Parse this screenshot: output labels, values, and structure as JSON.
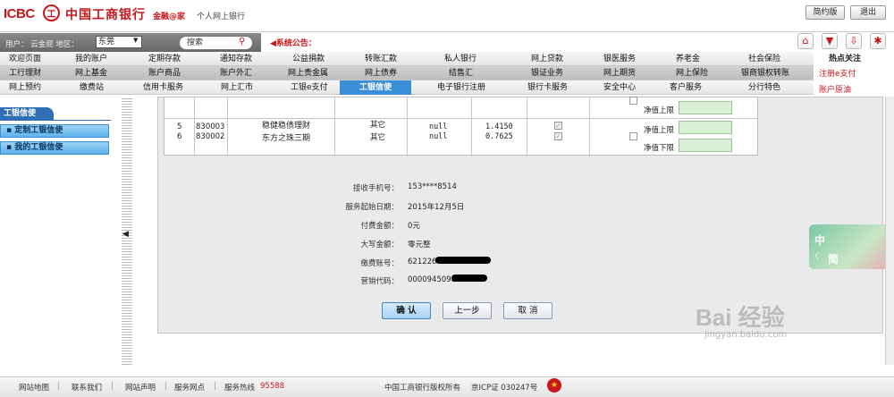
{
  "header": {
    "logo_text": "ICBC",
    "seal_glyph": "工",
    "bank_name": "中国工商银行",
    "slogan": "金融@家",
    "subtitle": "个人网上银行",
    "simple_btn": "简约版",
    "exit_btn": "退出"
  },
  "userbar": {
    "user_label": "用户： 云金屁   地区：",
    "region": "东莞",
    "search_placeholder": "搜索",
    "announcement": "◀系统公告："
  },
  "nav": {
    "row1": [
      "欢迎页面",
      "我的账户",
      "定期存款",
      "通知存款",
      "公益捐款",
      "转账汇款",
      "私人银行",
      "网上贷款",
      "银医服务",
      "养老金",
      "社会保险"
    ],
    "row2": [
      "工行理财",
      "网上基金",
      "账户商品",
      "账户外汇",
      "网上贵金属",
      "网上债券",
      "结售汇",
      "银证业务",
      "网上期货",
      "网上保险",
      "银商银权转账"
    ],
    "row3": [
      "网上预约",
      "缴费站",
      "信用卡服务",
      "网上汇市",
      "工银e支付",
      "工银信使",
      "电子银行注册",
      "银行卡服务",
      "安全中心",
      "客户服务",
      "分行特色"
    ],
    "active_tab": "工银信使"
  },
  "hot": {
    "title": "热点关注",
    "link1": "注册e支付",
    "link2": "账户原油"
  },
  "sidebar": {
    "title": "工银信使",
    "items": [
      {
        "label": "定制工银信使"
      },
      {
        "label": "我的工银信使"
      }
    ]
  },
  "table": {
    "rows": [
      {
        "no": "5",
        "code": "830003",
        "name": "稳健稳债理财",
        "type": "其它",
        "value": "null",
        "price": "1.4150",
        "checked": true
      },
      {
        "no": "6",
        "code": "830002",
        "name": "东方之珠三期",
        "type": "其它",
        "value": "null",
        "price": "0.7625",
        "checked": true
      }
    ],
    "upper_label": "净值上限",
    "lower_label": "净值下限"
  },
  "form": {
    "phone_label": "接收手机号：",
    "phone": "153****8514",
    "start_label": "服务起始日期：",
    "start": "2015年12月5日",
    "fee_label": "付费金额：",
    "fee": "0元",
    "fee_cn_label": "大写金额：",
    "fee_cn": "零元整",
    "account_label": "缴费账号：",
    "account": "621226",
    "marketing_label": "营销代码：",
    "marketing": "0000945098"
  },
  "buttons": {
    "confirm": "确 认",
    "back": "上一步",
    "cancel": "取 消"
  },
  "footer": {
    "sitemap": "网站地图",
    "contact": "联系我们",
    "statement": "网站声明",
    "outlets": "服务网点",
    "hotline_label": "服务热线",
    "hotline": "95588",
    "copyright": "中国工商银行版权所有",
    "icp": "京ICP证 030247号"
  },
  "widget": {
    "text1": "中",
    "text2": "简"
  },
  "watermark": {
    "brand": "Bai 经验",
    "url": "jingyan.baidu.com"
  },
  "colors": {
    "brand_red": "#c8161d",
    "sidebar_blue": "#2f6fb6",
    "active_tab": "#3a8fd6"
  }
}
